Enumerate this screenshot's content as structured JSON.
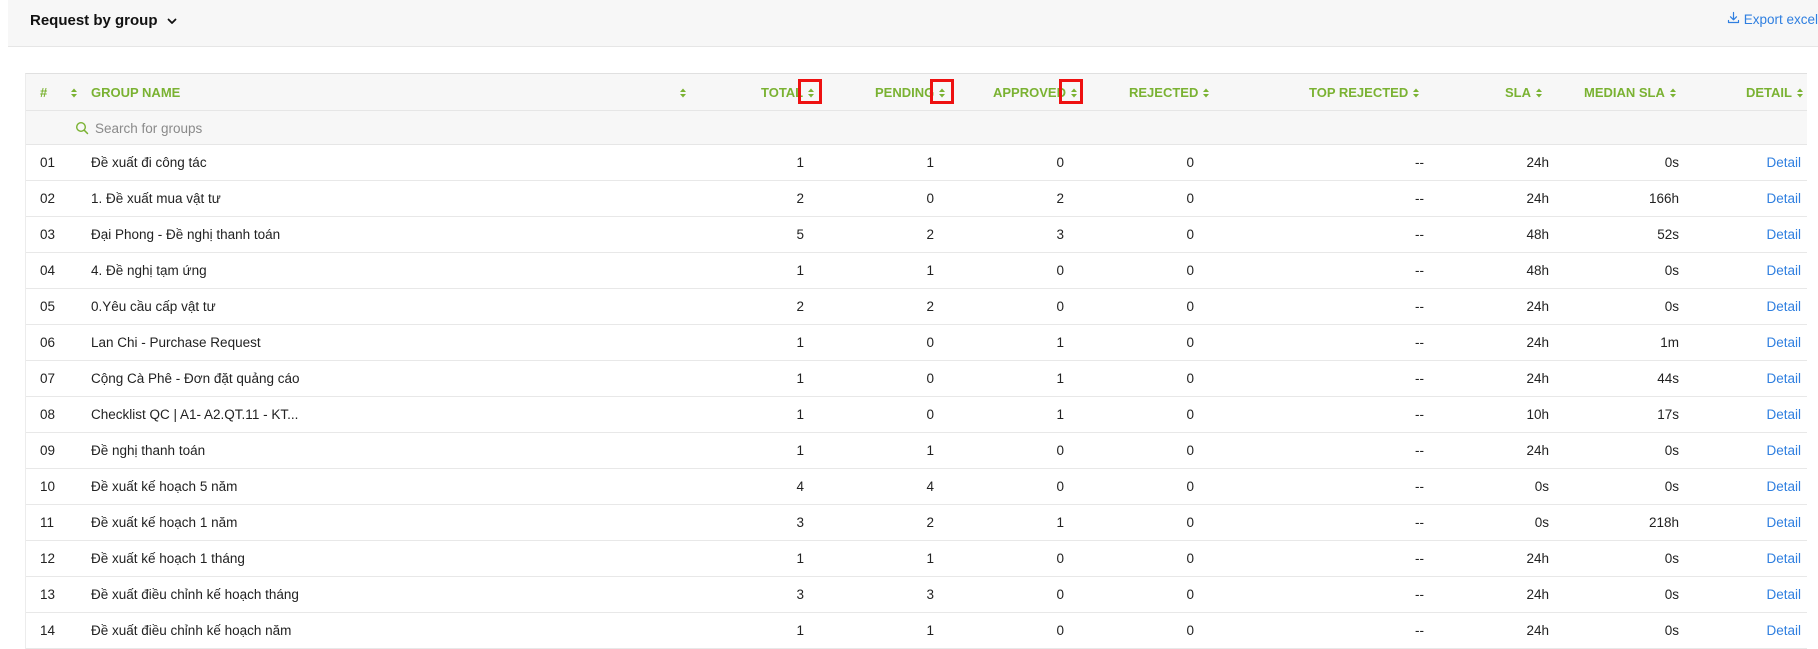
{
  "header": {
    "title": "Request by group",
    "export_label": "Export excel"
  },
  "table": {
    "columns": {
      "index": "#",
      "group_name": "GROUP NAME",
      "total": "TOTAL",
      "pending": "PENDING",
      "approved": "APPROVED",
      "rejected": "REJECTED",
      "top_rejected": "TOP REJECTED",
      "sla": "SLA",
      "median_sla": "MEDIAN SLA",
      "detail": "DETAIL"
    },
    "search_placeholder": "Search for groups",
    "rows": [
      {
        "index": "01",
        "name": "Đề xuất đi công tác",
        "total": "1",
        "pending": "1",
        "approved": "0",
        "rejected": "0",
        "top_rejected": "--",
        "sla": "24h",
        "median_sla": "0s",
        "detail": "Detail"
      },
      {
        "index": "02",
        "name": "1. Đề xuất mua vật tư",
        "total": "2",
        "pending": "0",
        "approved": "2",
        "rejected": "0",
        "top_rejected": "--",
        "sla": "24h",
        "median_sla": "166h",
        "detail": "Detail"
      },
      {
        "index": "03",
        "name": "Đại Phong - Đề nghị thanh toán",
        "total": "5",
        "pending": "2",
        "approved": "3",
        "rejected": "0",
        "top_rejected": "--",
        "sla": "48h",
        "median_sla": "52s",
        "detail": "Detail"
      },
      {
        "index": "04",
        "name": "4. Đề nghị tạm ứng",
        "total": "1",
        "pending": "1",
        "approved": "0",
        "rejected": "0",
        "top_rejected": "--",
        "sla": "48h",
        "median_sla": "0s",
        "detail": "Detail"
      },
      {
        "index": "05",
        "name": "0.Yêu cầu cấp vật tư",
        "total": "2",
        "pending": "2",
        "approved": "0",
        "rejected": "0",
        "top_rejected": "--",
        "sla": "24h",
        "median_sla": "0s",
        "detail": "Detail"
      },
      {
        "index": "06",
        "name": "Lan Chi - Purchase Request",
        "total": "1",
        "pending": "0",
        "approved": "1",
        "rejected": "0",
        "top_rejected": "--",
        "sla": "24h",
        "median_sla": "1m",
        "detail": "Detail"
      },
      {
        "index": "07",
        "name": "Cộng Cà Phê - Đơn đặt quảng cáo",
        "total": "1",
        "pending": "0",
        "approved": "1",
        "rejected": "0",
        "top_rejected": "--",
        "sla": "24h",
        "median_sla": "44s",
        "detail": "Detail"
      },
      {
        "index": "08",
        "name": "Checklist QC | A1- A2.QT.11 - KT...",
        "total": "1",
        "pending": "0",
        "approved": "1",
        "rejected": "0",
        "top_rejected": "--",
        "sla": "10h",
        "median_sla": "17s",
        "detail": "Detail"
      },
      {
        "index": "09",
        "name": "Đề nghị thanh toán",
        "total": "1",
        "pending": "1",
        "approved": "0",
        "rejected": "0",
        "top_rejected": "--",
        "sla": "24h",
        "median_sla": "0s",
        "detail": "Detail"
      },
      {
        "index": "10",
        "name": "Đề xuất kế hoạch 5 năm",
        "total": "4",
        "pending": "4",
        "approved": "0",
        "rejected": "0",
        "top_rejected": "--",
        "sla": "0s",
        "median_sla": "0s",
        "detail": "Detail"
      },
      {
        "index": "11",
        "name": "Đề xuất kế hoạch 1 năm",
        "total": "3",
        "pending": "2",
        "approved": "1",
        "rejected": "0",
        "top_rejected": "--",
        "sla": "0s",
        "median_sla": "218h",
        "detail": "Detail"
      },
      {
        "index": "12",
        "name": "Đề xuất kế hoạch 1 tháng",
        "total": "1",
        "pending": "1",
        "approved": "0",
        "rejected": "0",
        "top_rejected": "--",
        "sla": "24h",
        "median_sla": "0s",
        "detail": "Detail"
      },
      {
        "index": "13",
        "name": "Đề xuất điều chỉnh kế hoạch tháng",
        "total": "3",
        "pending": "3",
        "approved": "0",
        "rejected": "0",
        "top_rejected": "--",
        "sla": "24h",
        "median_sla": "0s",
        "detail": "Detail"
      },
      {
        "index": "14",
        "name": "Đề xuất điều chỉnh kế hoạch năm",
        "total": "1",
        "pending": "1",
        "approved": "0",
        "rejected": "0",
        "top_rejected": "--",
        "sla": "24h",
        "median_sla": "0s",
        "detail": "Detail"
      }
    ]
  },
  "icons": {
    "title_dropdown": "chevron-down-icon",
    "export": "download-icon",
    "search": "search-icon",
    "sort": "sort-icon"
  },
  "colors": {
    "header_text": "#7ab232",
    "link": "#2f7fe0",
    "highlight_box": "#ee1111"
  }
}
